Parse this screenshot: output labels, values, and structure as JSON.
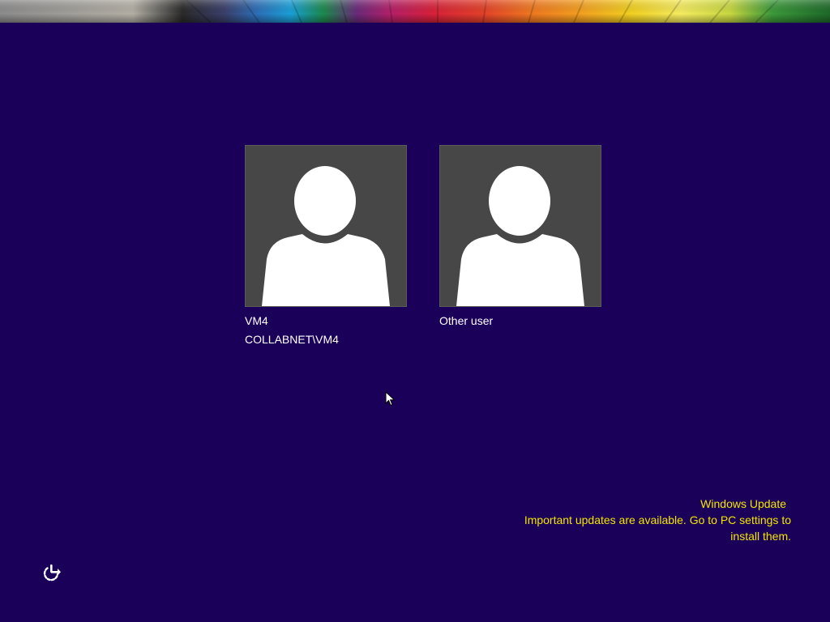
{
  "users": [
    {
      "name": "VM4",
      "account": "COLLABNET\\VM4"
    },
    {
      "name": "Other user"
    }
  ],
  "notification": {
    "title": "Windows Update",
    "line1": "Important updates are available. Go to PC settings to",
    "line2": "install them."
  },
  "icons": {
    "ease_of_access": "ease-of-access-icon",
    "user_avatar": "user-avatar-icon",
    "cursor": "mouse-pointer-icon"
  },
  "colors": {
    "background": "#1b0059",
    "tile": "#474747",
    "notice_text": "#f2e600",
    "user_text": "#ffffff"
  }
}
